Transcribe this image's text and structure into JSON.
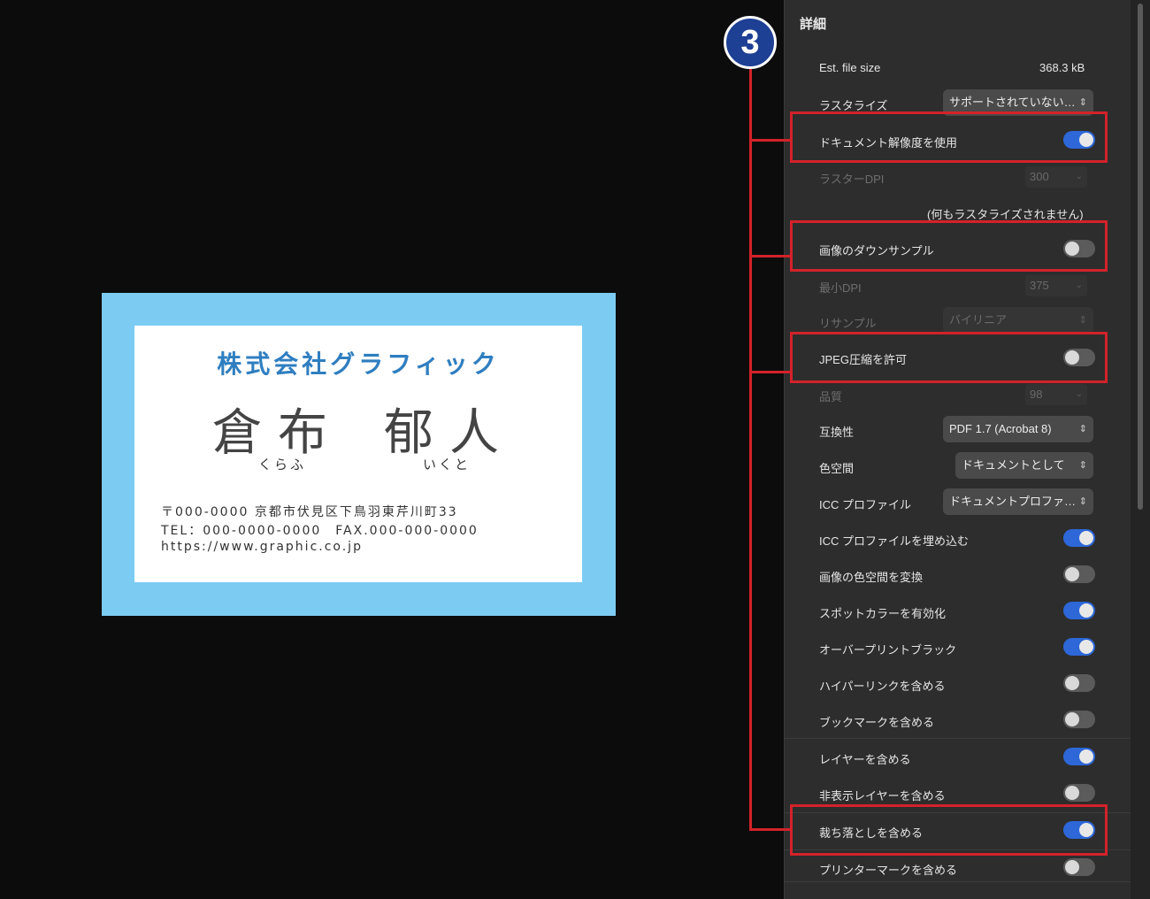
{
  "card": {
    "company": "株式会社グラフィック",
    "name_family": "倉布",
    "name_given": "郁人",
    "reading_family": "くらふ",
    "reading_given": "いくと",
    "address": "〒000-0000 京都市伏見区下鳥羽東芹川町33",
    "contact": "TEL：000-0000-0000　FAX.000-000-0000",
    "url": "https://www.graphic.co.jp",
    "colors": {
      "frame": "#7ccbf2",
      "company_text": "#2f7ec0"
    }
  },
  "panel": {
    "title": "詳細",
    "file_size_label": "Est. file size",
    "file_size_value": "368.3 kB",
    "rasterize_label": "ラスタライズ",
    "rasterize_value": "サポートされていない…",
    "use_doc_res_label": "ドキュメント解像度を使用",
    "use_doc_res_on": true,
    "raster_dpi_label": "ラスターDPI",
    "raster_dpi_value": "300",
    "raster_note": "(何もラスタライズされません)",
    "downsample_label": "画像のダウンサンプル",
    "downsample_on": false,
    "min_dpi_label": "最小DPI",
    "min_dpi_value": "375",
    "resample_label": "リサンプル",
    "resample_value": "バイリニア",
    "jpeg_label": "JPEG圧縮を許可",
    "jpeg_on": false,
    "quality_label": "品質",
    "quality_value": "98",
    "compat_label": "互換性",
    "compat_value": "PDF 1.7 (Acrobat 8)",
    "colorspace_label": "色空間",
    "colorspace_value": "ドキュメントとして",
    "icc_label": "ICC プロファイル",
    "icc_value": "ドキュメントプロファ…",
    "toggles": [
      {
        "label": "ICC プロファイルを埋め込む",
        "on": true
      },
      {
        "label": "画像の色空間を変換",
        "on": false
      },
      {
        "label": "スポットカラーを有効化",
        "on": true
      },
      {
        "label": "オーバープリントブラック",
        "on": true
      },
      {
        "label": "ハイパーリンクを含める",
        "on": false
      },
      {
        "label": "ブックマークを含める",
        "on": false
      },
      {
        "label": "レイヤーを含める",
        "on": true
      },
      {
        "label": "非表示レイヤーを含める",
        "on": false
      },
      {
        "label": "裁ち落としを含める",
        "on": true
      },
      {
        "label": "プリンターマークを含める",
        "on": false
      }
    ],
    "accent_color": "#2d67d8"
  },
  "annotation": {
    "badge": "3",
    "color": "#d3222a"
  }
}
